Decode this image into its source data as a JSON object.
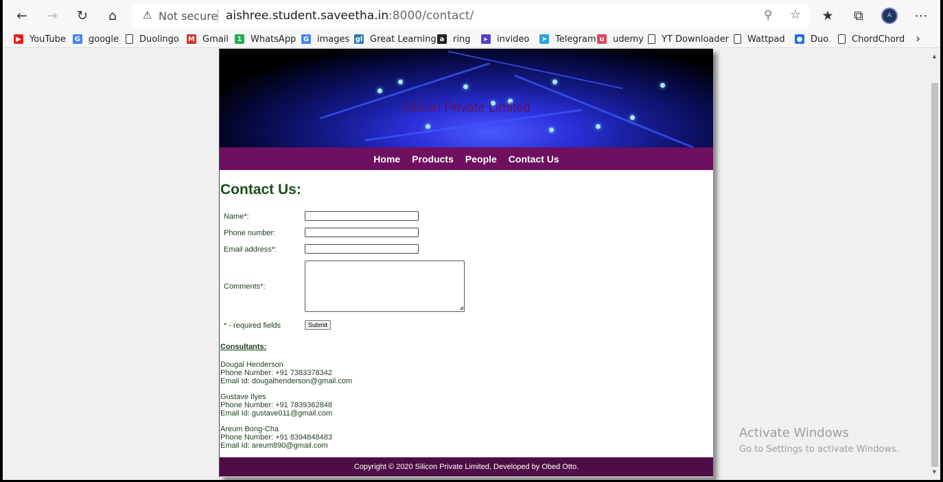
{
  "browser": {
    "security_label": "Not secure",
    "url_host": "aishree.student.saveetha.in",
    "url_rest": ":8000/contact/",
    "profile_initials": "A",
    "icons": {
      "back": "←",
      "forward": "→",
      "refresh": "↻",
      "home": "⌂",
      "warning": "⚠",
      "zoom": "⚲",
      "star": "☆",
      "favorites": "★",
      "collections": "⧉",
      "menu": "⋯",
      "more": "›",
      "scroll_up": "▲",
      "scroll_down": "▼",
      "resize": "◢"
    }
  },
  "bookmarks": [
    {
      "label": "YouTube",
      "icon": "youtube-icon",
      "glyph": "▶",
      "color": "#e62117"
    },
    {
      "label": "google",
      "icon": "google-icon",
      "glyph": "G",
      "color": "#4285f4"
    },
    {
      "label": "Duolingo",
      "icon": "page-icon",
      "glyph": "",
      "color": "#ffffff"
    },
    {
      "label": "Gmail",
      "icon": "gmail-icon",
      "glyph": "M",
      "color": "#d93025"
    },
    {
      "label": "WhatsApp",
      "icon": "whatsapp-icon",
      "glyph": "1",
      "color": "#1bb14a"
    },
    {
      "label": "images",
      "icon": "google-icon",
      "glyph": "G",
      "color": "#4285f4"
    },
    {
      "label": "Great Learning",
      "icon": "greatlearning-icon",
      "glyph": "gl",
      "color": "#2a7ab0"
    },
    {
      "label": "ring",
      "icon": "amazon-icon",
      "glyph": "a",
      "color": "#222222"
    },
    {
      "label": "invideo",
      "icon": "invideo-icon",
      "glyph": "▸",
      "color": "#5a3ec8"
    },
    {
      "label": "Telegram",
      "icon": "telegram-icon",
      "glyph": "➤",
      "color": "#2aa3e0"
    },
    {
      "label": "udemy",
      "icon": "udemy-icon",
      "glyph": "u",
      "color": "#e0455a"
    },
    {
      "label": "YT Downloader",
      "icon": "page-icon",
      "glyph": "",
      "color": "#ffffff"
    },
    {
      "label": "Wattpad",
      "icon": "page-icon",
      "glyph": "",
      "color": "#ffffff"
    },
    {
      "label": "Duo",
      "icon": "duo-icon",
      "glyph": "●",
      "color": "#1a73e8"
    },
    {
      "label": "ChordChord",
      "icon": "page-icon",
      "glyph": "",
      "color": "#ffffff"
    }
  ],
  "site": {
    "title": "Silicon Private Limited",
    "nav": [
      "Home",
      "Products",
      "People",
      "Contact Us"
    ],
    "heading": "Contact Us:",
    "form": {
      "name_label": "Name*:",
      "phone_label": "Phone number:",
      "email_label": "Email address*:",
      "comments_label": "Comments*:",
      "required_note": "* - required fields",
      "submit_label": "Submit",
      "name_value": "",
      "phone_value": "",
      "email_value": "",
      "comments_value": ""
    },
    "consultants_heading": "Consultants:",
    "consultants": [
      {
        "name": "Dougal Henderson",
        "phone": "Phone Number: +91 7383378342",
        "email": "Email Id: dougalhenderson@gmail.com"
      },
      {
        "name": "Gustave Ilyes",
        "phone": "Phone Number: +91 7839362848",
        "email": "Email Id: gustave011@gmail.com"
      },
      {
        "name": "Areum Bong-Cha",
        "phone": "Phone Number: +91 8394848483",
        "email": "Email Id: areum890@gmail.com"
      }
    ],
    "footer": "Copyright © 2020 Silicon Private Limited, Developed by Obed Otto."
  },
  "os": {
    "activate_title": "Activate Windows",
    "activate_sub": "Go to Settings to activate Windows."
  },
  "colors": {
    "nav_bg": "#6f0f5f",
    "footer_bg": "#4e0e45",
    "heading": "#1b4d1b"
  }
}
